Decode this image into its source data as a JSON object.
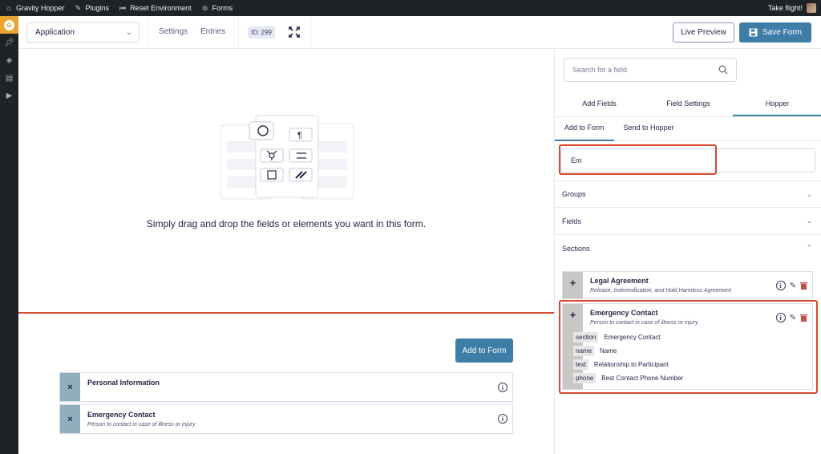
{
  "adminbar": {
    "site_name": "Gravity Hopper",
    "plugins": "Plugins",
    "reset": "Reset Environment",
    "forms": "Forms",
    "greeting": "Take flight!"
  },
  "toolbar": {
    "form_name": "Application",
    "settings": "Settings",
    "entries": "Entries",
    "form_id": "ID: 299",
    "live_preview": "Live Preview",
    "save_form": "Save Form"
  },
  "canvas": {
    "empty_text": "Simply drag and drop the fields or elements you want in this form.",
    "add_to_form": "Add to Form",
    "sections": [
      {
        "title": "Personal Information",
        "desc": ""
      },
      {
        "title": "Emergency Contact",
        "desc": "Person to contact in case of illness or injury"
      }
    ]
  },
  "sidebar": {
    "search_placeholder": "Search for a field",
    "tabs": [
      "Add Fields",
      "Field Settings",
      "Hopper"
    ],
    "subtabs": [
      "Add to Form",
      "Send to Hopper"
    ],
    "hopper_search_value": "Em",
    "accordions": [
      "Groups",
      "Fields",
      "Sections"
    ],
    "cards": [
      {
        "title": "Legal Agreement",
        "desc": "Release, Indemnification, and Hold Harmless Agreement"
      },
      {
        "title": "Emergency Contact",
        "desc": "Person to contact in case of illness or injury",
        "fields": [
          {
            "type": "section",
            "label": "Emergency Contact"
          },
          {
            "type": "name",
            "label": "Name"
          },
          {
            "type": "text",
            "label": "Relationship to Participant"
          },
          {
            "type": "phone",
            "label": "Best Contact Phone Number"
          }
        ]
      }
    ]
  },
  "colors": {
    "accent": "#3e7da6",
    "highlight": "#d5492e",
    "admin_bg": "#1d2327",
    "menu_active": "#e8a331"
  }
}
